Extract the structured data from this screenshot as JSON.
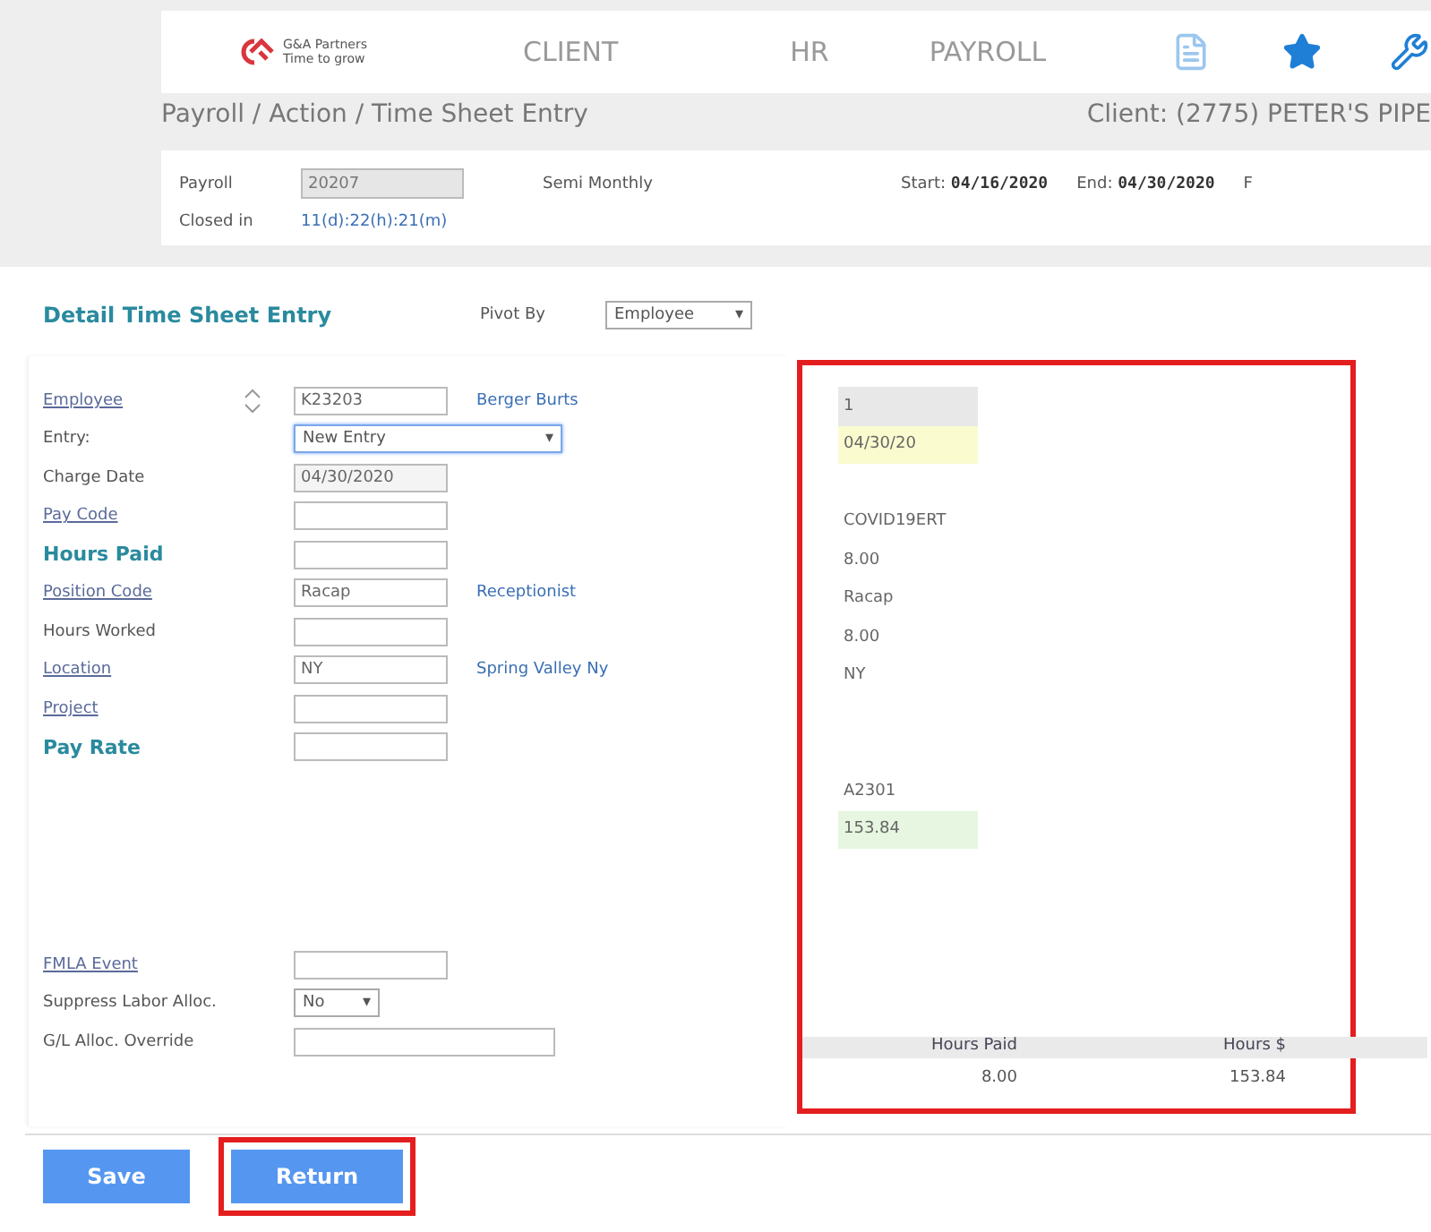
{
  "nav": {
    "logo_text": "G&A Partners",
    "logo_tagline": "Time to grow",
    "items": [
      {
        "label": "CLIENT",
        "selected": false
      },
      {
        "label": "HR",
        "selected": false
      },
      {
        "label": "PAYROLL",
        "selected": false
      }
    ]
  },
  "breadcrumb": "Payroll / Action / Time Sheet Entry",
  "client": "Client: (2775) PETER'S PIPE",
  "payroll_info": {
    "payroll_label": "Payroll",
    "payroll_value": "20207",
    "frequency": "Semi Monthly",
    "start_label": "Start:",
    "start": "04/16/2020",
    "end_label": "End:",
    "end": "04/30/2020",
    "cut_label": "F",
    "closed_label": "Closed in",
    "closed_value": "11(d):22(h):21(m)"
  },
  "detail": {
    "title": "Detail Time Sheet Entry",
    "pivot_label": "Pivot By",
    "pivot_value": "Employee",
    "pivot_arrow": "▾"
  },
  "fields": [
    {
      "label": {
        "text": "Employee",
        "kind": "link"
      },
      "kind": "input",
      "value": "K23203",
      "note": "Berger Burts",
      "spinner": true
    },
    {
      "label": {
        "text": "Entry:",
        "kind": "plain"
      },
      "kind": "select",
      "value": "New Entry",
      "arrow": "▾"
    },
    {
      "label": {
        "text": "Charge Date",
        "kind": "plain"
      },
      "kind": "readonly",
      "value": "04/30/2020"
    },
    {
      "label": {
        "text": "Pay Code",
        "kind": "link"
      },
      "kind": "input"
    },
    {
      "label": {
        "text": "Hours Paid",
        "kind": "bold"
      },
      "kind": "input"
    },
    {
      "label": {
        "text": "Position Code",
        "kind": "link"
      },
      "kind": "input",
      "value": "Racap",
      "note": "Receptionist"
    },
    {
      "label": {
        "text": "Hours Worked",
        "kind": "plain"
      },
      "kind": "input"
    },
    {
      "label": {
        "text": "Location",
        "kind": "link"
      },
      "kind": "input",
      "value": "NY",
      "note": "Spring Valley Ny"
    },
    {
      "label": {
        "text": "Project",
        "kind": "link"
      },
      "kind": "input"
    },
    {
      "label": {
        "text": "Pay Rate",
        "kind": "bold"
      },
      "kind": "input"
    }
  ],
  "extra_fields": [
    {
      "label": {
        "text": "FMLA Event",
        "kind": "link"
      },
      "kind": "input"
    },
    {
      "label": {
        "text": "Suppress Labor Alloc.",
        "kind": "plain"
      },
      "kind": "small_select",
      "value": "No",
      "arrow": "▾"
    },
    {
      "label": {
        "text": "G/L Alloc. Override",
        "kind": "plain"
      },
      "kind": "wide_input"
    }
  ],
  "summary_column": [
    {
      "kind": "value",
      "text": "1",
      "color": "#e8e8e8"
    },
    {
      "kind": "value",
      "text": "04/30/20",
      "color": "#fbfbd0"
    },
    {
      "kind": "spacer"
    },
    {
      "kind": "value",
      "text": "COVID19ERT"
    },
    {
      "kind": "value",
      "text": "8.00"
    },
    {
      "kind": "value",
      "text": "Racap"
    },
    {
      "kind": "value",
      "text": "8.00"
    },
    {
      "kind": "value",
      "text": "NY"
    },
    {
      "kind": "spacer"
    },
    {
      "kind": "spacer"
    },
    {
      "kind": "value",
      "text": "A2301"
    },
    {
      "kind": "value",
      "text": "153.84",
      "color": "#e6f6e0"
    }
  ],
  "totals": {
    "columns": [
      "Hours Paid",
      "Hours $"
    ],
    "values": [
      "8.00",
      "153.84"
    ]
  },
  "buttons": [
    {
      "label": "Save",
      "highlighted": false
    },
    {
      "label": "Return",
      "highlighted": true
    }
  ]
}
